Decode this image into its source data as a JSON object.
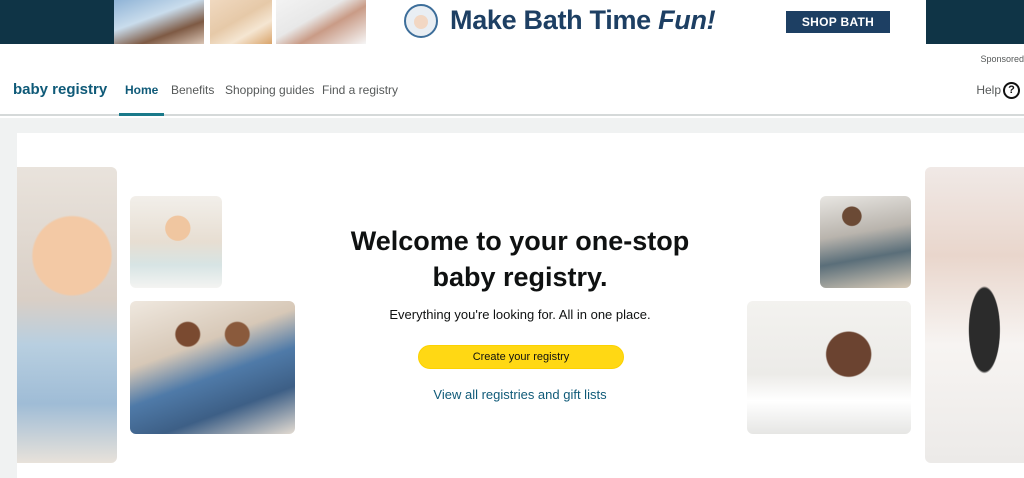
{
  "ad": {
    "headline_main": "Make Bath Time ",
    "headline_em": "Fun!",
    "cta": "SHOP BATH",
    "sponsored": "Sponsored",
    "colors": {
      "band": "#0f3446",
      "text": "#1d3f63"
    }
  },
  "nav": {
    "brand": "baby registry",
    "items": [
      {
        "label": "Home",
        "active": true
      },
      {
        "label": "Benefits"
      },
      {
        "label": "Shopping guides"
      },
      {
        "label": "Find a registry"
      }
    ],
    "help": "Help",
    "help_icon": "question-circle-icon"
  },
  "hero": {
    "title": "Welcome to your one-stop baby registry.",
    "subtitle": "Everything you're looking for. All in one place.",
    "primary_cta": "Create your registry",
    "secondary_link": "View all registries and gift lists",
    "colors": {
      "cta_bg": "#ffd814",
      "link": "#0f5a78",
      "accent": "#1a7a8a"
    }
  }
}
